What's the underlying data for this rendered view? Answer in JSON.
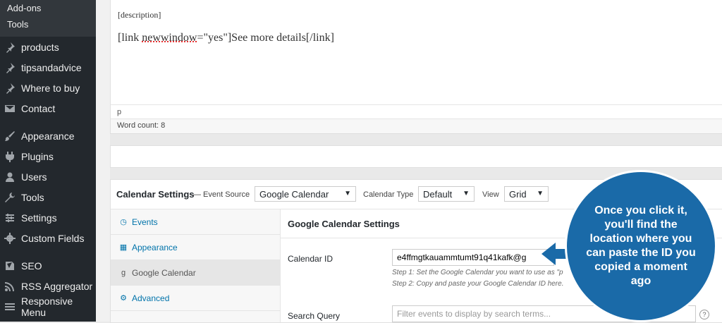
{
  "sidebar": {
    "subitems": [
      "Add-ons",
      "Tools"
    ],
    "items": [
      {
        "label": "products",
        "icon": "pin-icon"
      },
      {
        "label": "tipsandadvice",
        "icon": "pin-icon"
      },
      {
        "label": "Where to buy",
        "icon": "pin-icon"
      },
      {
        "label": "Contact",
        "icon": "mail-icon"
      },
      {
        "label": "Appearance",
        "icon": "brush-icon"
      },
      {
        "label": "Plugins",
        "icon": "plugin-icon"
      },
      {
        "label": "Users",
        "icon": "user-icon"
      },
      {
        "label": "Tools",
        "icon": "wrench-icon"
      },
      {
        "label": "Settings",
        "icon": "settings-icon"
      },
      {
        "label": "Custom Fields",
        "icon": "gear-icon"
      },
      {
        "label": "SEO",
        "icon": "seo-icon"
      },
      {
        "label": "RSS Aggregator",
        "icon": "rss-icon"
      },
      {
        "label": "Responsive Menu",
        "icon": "menu-icon"
      }
    ]
  },
  "editor": {
    "shortcode_description": "[description]",
    "link_open": "[link ",
    "link_attr": "newwindow",
    "link_rest": "=\"yes\"]See more details[/link]",
    "path": "p",
    "word_count": "Word count: 8"
  },
  "calendar": {
    "title": "Calendar Settings",
    "event_source_label": "— Event Source",
    "event_source_value": "Google Calendar",
    "calendar_type_label": "Calendar Type",
    "calendar_type_value": "Default",
    "view_label": "View",
    "view_value": "Grid",
    "tabs": [
      {
        "label": "Events",
        "icon": "clock-icon",
        "glyph": "◷"
      },
      {
        "label": "Appearance",
        "icon": "calendar-icon",
        "glyph": "▦"
      },
      {
        "label": "Google Calendar",
        "icon": "google-icon",
        "glyph": "g"
      },
      {
        "label": "Advanced",
        "icon": "cogs-icon",
        "glyph": "⚙"
      }
    ],
    "section_title": "Google Calendar Settings",
    "calendar_id_label": "Calendar ID",
    "calendar_id_value": "e4ffmgtkauammtumt91q41kafk@g",
    "step1": "Step 1: Set the Google Calendar you want to use as \"p",
    "step2": "Step 2: Copy and paste your Google Calendar ID here.",
    "search_label": "Search Query",
    "search_placeholder": "Filter events to display by search terms...",
    "help_glyph": "?"
  },
  "callout": {
    "text": "Once you click it, you'll find the location where you can paste the ID you copied a moment ago",
    "color": "#1a6aa8"
  }
}
